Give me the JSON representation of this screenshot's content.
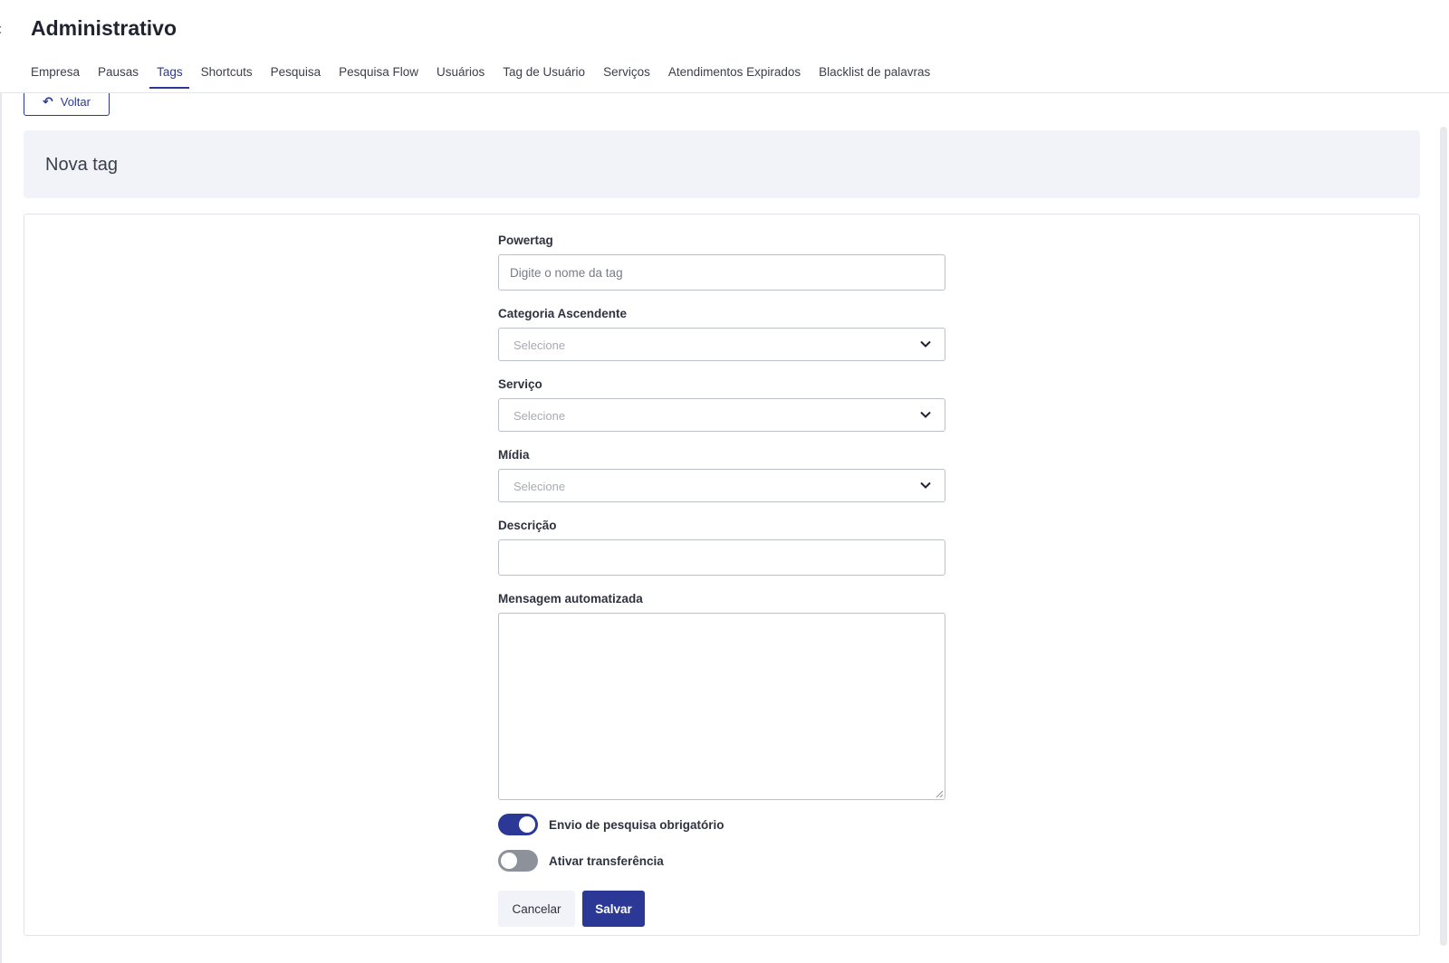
{
  "header": {
    "title": "Administrativo",
    "tabs": [
      {
        "label": "Empresa"
      },
      {
        "label": "Pausas"
      },
      {
        "label": "Tags",
        "active": true
      },
      {
        "label": "Shortcuts"
      },
      {
        "label": "Pesquisa"
      },
      {
        "label": "Pesquisa Flow"
      },
      {
        "label": "Usuários"
      },
      {
        "label": "Tag de Usuário"
      },
      {
        "label": "Serviços"
      },
      {
        "label": "Atendimentos Expirados"
      },
      {
        "label": "Blacklist de palavras"
      }
    ]
  },
  "back_button": {
    "label": "Voltar"
  },
  "section": {
    "title": "Nova tag"
  },
  "form": {
    "powertag": {
      "label": "Powertag",
      "placeholder": "Digite o nome da tag",
      "value": ""
    },
    "categoria": {
      "label": "Categoria Ascendente",
      "value": "Selecione"
    },
    "servico": {
      "label": "Serviço",
      "value": "Selecione"
    },
    "midia": {
      "label": "Mídia",
      "value": "Selecione"
    },
    "descricao": {
      "label": "Descrição",
      "value": ""
    },
    "mensagem": {
      "label": "Mensagem automatizada",
      "value": ""
    },
    "toggle_pesquisa": {
      "label": "Envio de pesquisa obrigatório",
      "checked": true
    },
    "toggle_transferencia": {
      "label": "Ativar transferência",
      "checked": false
    },
    "cancel_label": "Cancelar",
    "save_label": "Salvar"
  },
  "colors": {
    "primary": "#2b3896",
    "section_bg": "#f1f3f8",
    "toggle_off": "#8d929a"
  }
}
